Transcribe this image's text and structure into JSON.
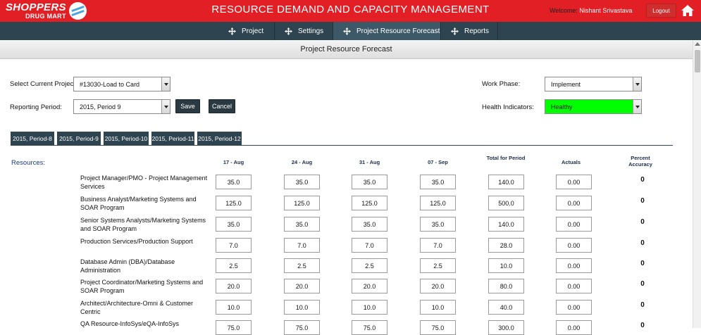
{
  "header": {
    "logo_line1": "SHOPPERS",
    "logo_line2": "DRUG MART",
    "title": "RESOURCE DEMAND AND CAPACITY MANAGEMENT",
    "welcome_label": "Welcome:",
    "user_name": "Nishant Srivastava",
    "logout_label": "Logout"
  },
  "nav": {
    "items": [
      {
        "label": "Project"
      },
      {
        "label": "Settings"
      },
      {
        "label": "Project Resource Forecast"
      },
      {
        "label": "Reports"
      }
    ],
    "active_index": 2
  },
  "page_title": "Project Resource Forecast",
  "form": {
    "project_label": "Select Current Project:",
    "project_value": "#13030-Load to Card",
    "period_label": "Reporting Period:",
    "period_value": "2015, Period 9",
    "save_label": "Save",
    "cancel_label": "Cancel",
    "phase_label": "Work Phase:",
    "phase_value": "Implement",
    "health_label": "Health Indicators:",
    "health_value": "Healthy",
    "health_color": "#00ff00"
  },
  "period_tabs": [
    "2015, Period-8",
    "2015, Period-9",
    "2015, Period-10",
    "2015, Period-11",
    "2015, Period-12"
  ],
  "grid": {
    "resources_label": "Resources:",
    "columns": {
      "c1": "17 - Aug",
      "c2": "24 - Aug",
      "c3": "31 - Aug",
      "c4": "07 - Sep",
      "total": "Total for Period",
      "actuals": "Actuals",
      "accuracy": "Percent Accuracy"
    },
    "rows": [
      {
        "name": "Project Manager/PMO - Project Management Services",
        "w1": "35.0",
        "w2": "35.0",
        "w3": "35.0",
        "w4": "35.0",
        "total": "140.0",
        "actuals": "0.00",
        "accuracy": "0"
      },
      {
        "name": "Business Analyst/Marketing Systems and SOAR Program",
        "w1": "125.0",
        "w2": "125.0",
        "w3": "125.0",
        "w4": "125.0",
        "total": "500.0",
        "actuals": "0.00",
        "accuracy": "0"
      },
      {
        "name": "Senior Systems Analysts/Marketing Systems and SOAR Program",
        "w1": "35.0",
        "w2": "35.0",
        "w3": "35.0",
        "w4": "35.0",
        "total": "140.0",
        "actuals": "0.00",
        "accuracy": "0"
      },
      {
        "name": "Production Services/Production Support",
        "w1": "7.0",
        "w2": "7.0",
        "w3": "7.0",
        "w4": "7.0",
        "total": "28.0",
        "actuals": "0.00",
        "accuracy": "0"
      },
      {
        "name": "Database Admin (DBA)/Database Administration",
        "w1": "2.5",
        "w2": "2.5",
        "w3": "2.5",
        "w4": "2.5",
        "total": "10.0",
        "actuals": "0.00",
        "accuracy": "0"
      },
      {
        "name": "Project Coordinator/Marketing Systems and SOAR Program",
        "w1": "20.0",
        "w2": "20.0",
        "w3": "20.0",
        "w4": "20.0",
        "total": "80.0",
        "actuals": "0.00",
        "accuracy": "0"
      },
      {
        "name": "Architect/Architecture-Omni & Customer Centric",
        "w1": "10.0",
        "w2": "10.0",
        "w3": "10.0",
        "w4": "10.0",
        "total": "40.0",
        "actuals": "0.00",
        "accuracy": "0"
      },
      {
        "name": "QA Resource-InfoSys/eQA-InfoSys",
        "w1": "75.0",
        "w2": "75.0",
        "w3": "75.0",
        "w4": "75.0",
        "total": "300.0",
        "actuals": "0.00",
        "accuracy": "0"
      }
    ]
  }
}
